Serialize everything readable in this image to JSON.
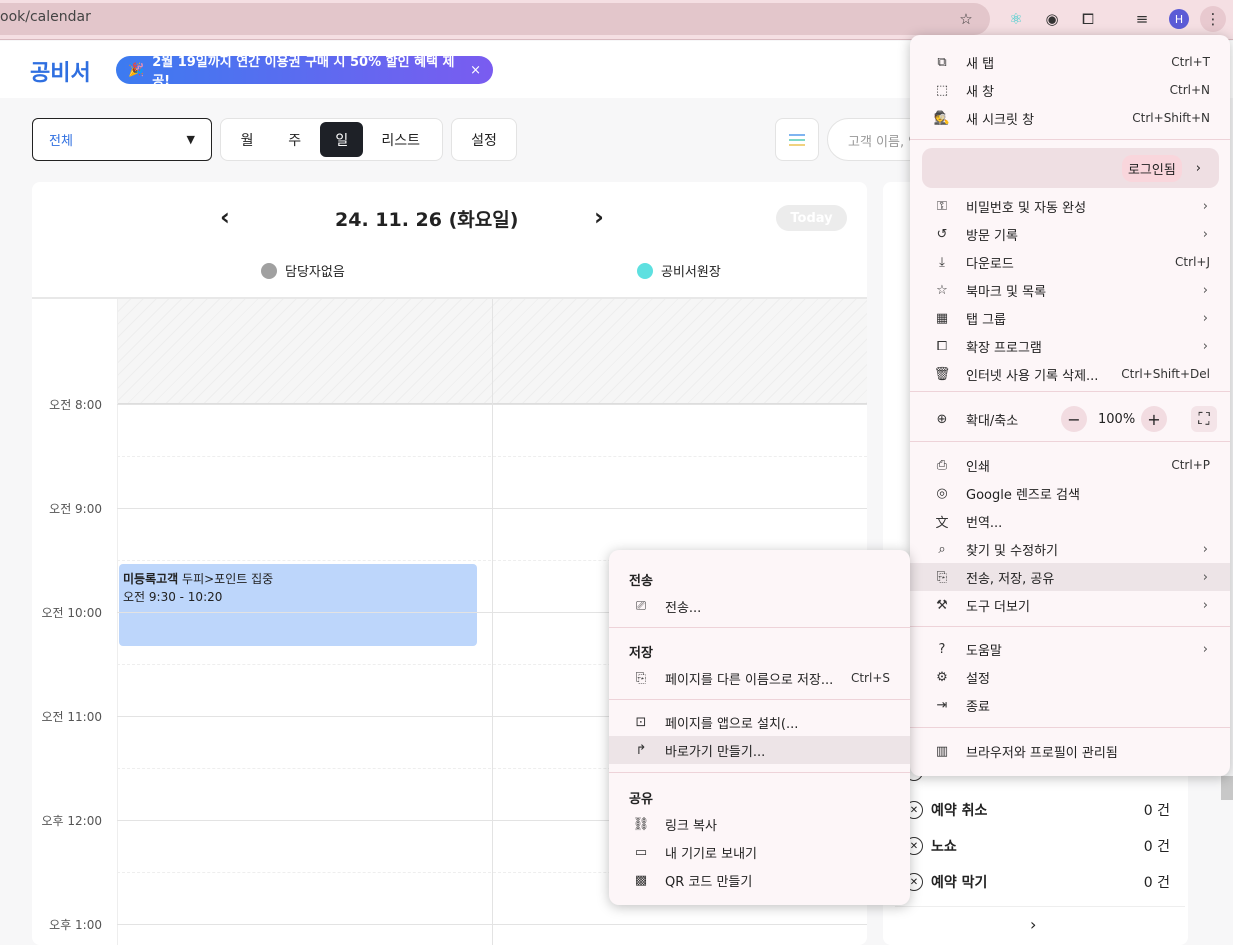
{
  "browser": {
    "url": "ook/calendar",
    "avatar": "H",
    "icons": [
      "star-icon",
      "react-devtools-icon",
      "extension-disk-icon",
      "puzzle-icon",
      "media-queue-icon",
      "kebab-menu-icon"
    ]
  },
  "app": {
    "logo": "공비서",
    "promo": "2월 19일까지 연간 이용권 구매 시 50% 할인 혜택 제공!",
    "promo_close": "×",
    "filter": "전체",
    "views": [
      "월",
      "주",
      "일",
      "리스트"
    ],
    "active_view": "일",
    "settings": "설정",
    "search_placeholder": "고객 이름, 연",
    "date": "24. 11. 26 (화요일)",
    "prev": "‹",
    "next": "›",
    "today": "Today",
    "staff": [
      {
        "name": "담당자없음",
        "color": "#a0a0a0"
      },
      {
        "name": "공비서원장",
        "color": "#5ee0e0"
      }
    ],
    "hours": [
      "오전 8:00",
      "오전 9:00",
      "오전 10:00",
      "오전 11:00",
      "오후 12:00",
      "오후 1:00"
    ],
    "event": {
      "customer": "미등록고객",
      "service": "두피>포인트 집중",
      "time": "오전 9:30 - 10:20",
      "color": "#bdd6fb"
    },
    "stats": [
      {
        "label": "예약 취소",
        "count": "0 건"
      },
      {
        "label": "노쇼",
        "count": "0 건"
      },
      {
        "label": "예약 막기",
        "count": "0 건"
      }
    ],
    "panel_next": "›"
  },
  "chrome_menu": {
    "top": [
      {
        "icon": "new-tab-icon",
        "g": "⧉",
        "label": "새 탭",
        "sc": "Ctrl+T"
      },
      {
        "icon": "new-window-icon",
        "g": "⬚",
        "label": "새 창",
        "sc": "Ctrl+N"
      },
      {
        "icon": "incognito-icon",
        "g": "🕵",
        "label": "새 시크릿 창",
        "sc": "Ctrl+Shift+N"
      }
    ],
    "profile": "로그인됨",
    "mid": [
      {
        "icon": "key-icon",
        "g": "⚿",
        "label": "비밀번호 및 자동 완성",
        "sub": true
      },
      {
        "icon": "history-icon",
        "g": "↺",
        "label": "방문 기록",
        "sub": true
      },
      {
        "icon": "download-icon",
        "g": "⤓",
        "label": "다운로드",
        "sc": "Ctrl+J"
      },
      {
        "icon": "bookmark-star-icon",
        "g": "☆",
        "label": "북마크 및 목록",
        "sub": true
      },
      {
        "icon": "tab-groups-icon",
        "g": "▦",
        "label": "탭 그룹",
        "sub": true
      },
      {
        "icon": "extension-icon",
        "g": "⧠",
        "label": "확장 프로그램",
        "sub": true
      },
      {
        "icon": "trash-icon",
        "g": "🗑",
        "label": "인터넷 사용 기록 삭제...",
        "sc": "Ctrl+Shift+Del"
      }
    ],
    "zoom": {
      "label": "확대/축소",
      "value": "100%",
      "minus": "−",
      "plus": "+"
    },
    "tools": [
      {
        "icon": "print-icon",
        "g": "⎙",
        "label": "인쇄",
        "sc": "Ctrl+P"
      },
      {
        "icon": "lens-icon",
        "g": "◎",
        "label": "Google 렌즈로 검색"
      },
      {
        "icon": "translate-icon",
        "g": "文",
        "label": "번역..."
      },
      {
        "icon": "find-icon",
        "g": "⌕",
        "label": "찾기 및 수정하기",
        "sub": true
      },
      {
        "icon": "cast-save-share-icon",
        "g": "⎘",
        "label": "전송, 저장, 공유",
        "sub": true,
        "hl": true
      },
      {
        "icon": "toolbox-icon",
        "g": "⚒",
        "label": "도구 더보기",
        "sub": true
      }
    ],
    "help": [
      {
        "icon": "help-icon",
        "g": "?",
        "label": "도움말",
        "sub": true
      },
      {
        "icon": "settings-icon",
        "g": "⚙",
        "label": "설정"
      },
      {
        "icon": "exit-icon",
        "g": "⇥",
        "label": "종료"
      }
    ],
    "managed": {
      "icon": "building-icon",
      "g": "▥",
      "label": "브라우저와 프로필이 관리됨"
    }
  },
  "submenu": {
    "cast_head": "전송",
    "cast": {
      "g": "⎚",
      "label": "전송..."
    },
    "save_head": "저장",
    "save": {
      "g": "⎘",
      "label": "페이지를 다른 이름으로 저장...",
      "sc": "Ctrl+S"
    },
    "install": {
      "g": "⊡",
      "label": "페이지를 앱으로 설치(..."
    },
    "shortcut": {
      "g": "↱",
      "label": "바로가기 만들기..."
    },
    "share_head": "공유",
    "share": [
      {
        "icon": "link-icon",
        "g": "⛓",
        "label": "링크 복사"
      },
      {
        "icon": "send-device-icon",
        "g": "▭",
        "label": "내 기기로 보내기"
      },
      {
        "icon": "qr-icon",
        "g": "▩",
        "label": "QR 코드 만들기"
      }
    ]
  }
}
